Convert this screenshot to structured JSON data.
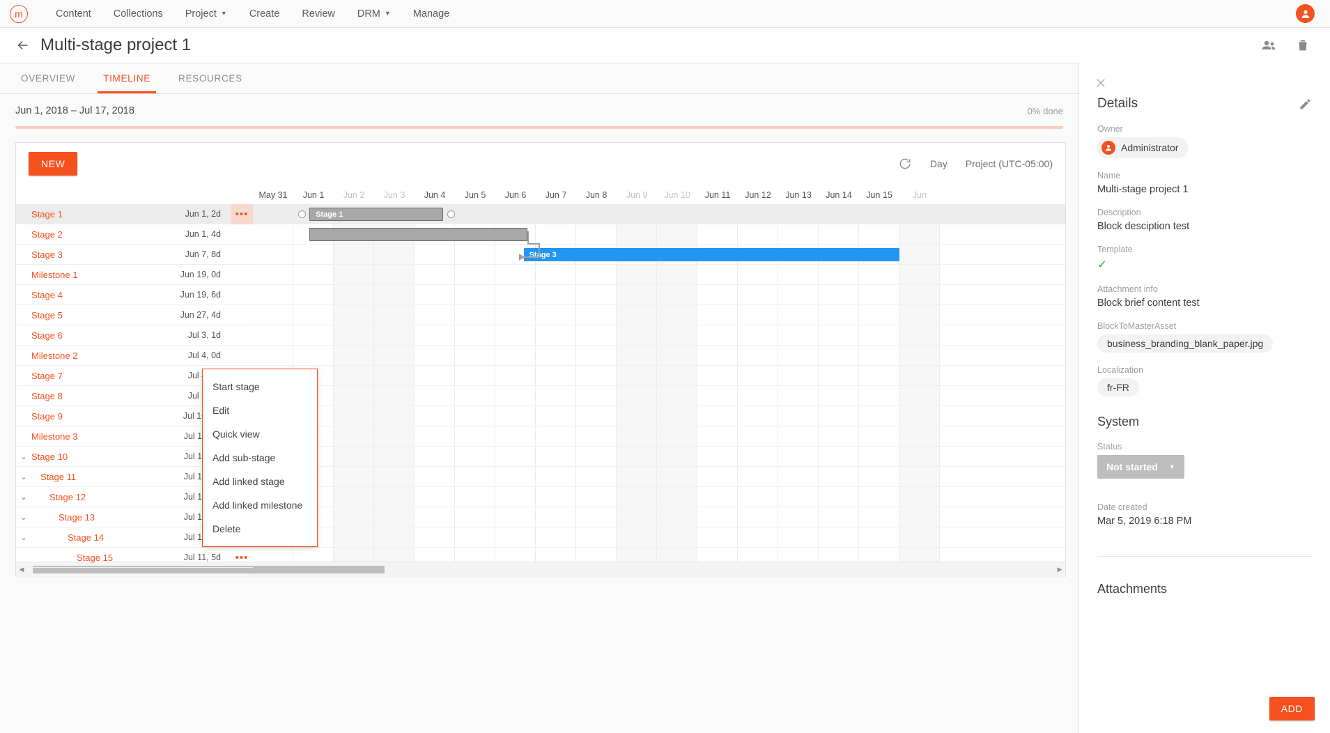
{
  "topnav": {
    "logo_letter": "m",
    "items": [
      {
        "label": "Content",
        "caret": false
      },
      {
        "label": "Collections",
        "caret": false
      },
      {
        "label": "Project",
        "caret": true
      },
      {
        "label": "Create",
        "caret": false
      },
      {
        "label": "Review",
        "caret": false
      },
      {
        "label": "DRM",
        "caret": true
      },
      {
        "label": "Manage",
        "caret": false
      }
    ]
  },
  "header": {
    "title": "Multi-stage project 1",
    "back_icon": "arrow-left-icon",
    "share_icon": "people-icon",
    "delete_icon": "trash-icon"
  },
  "tabs": [
    {
      "label": "OVERVIEW",
      "active": false
    },
    {
      "label": "TIMELINE",
      "active": true
    },
    {
      "label": "RESOURCES",
      "active": false
    }
  ],
  "summary": {
    "date_range": "Jun 1, 2018 – Jul 17, 2018",
    "done_label": "0%  done",
    "progress_percent": 0
  },
  "gantt_toolbar": {
    "new_label": "NEW",
    "refresh_icon": "refresh-icon",
    "scale_label": "Day",
    "timezone_label": "Project (UTC-05:00)"
  },
  "timeline_header": [
    {
      "label": "May 31",
      "weekend": false
    },
    {
      "label": "Jun 1",
      "weekend": false
    },
    {
      "label": "Jun 2",
      "weekend": true
    },
    {
      "label": "Jun 3",
      "weekend": true
    },
    {
      "label": "Jun 4",
      "weekend": false
    },
    {
      "label": "Jun 5",
      "weekend": false
    },
    {
      "label": "Jun 6",
      "weekend": false
    },
    {
      "label": "Jun 7",
      "weekend": false
    },
    {
      "label": "Jun 8",
      "weekend": false
    },
    {
      "label": "Jun 9",
      "weekend": true
    },
    {
      "label": "Jun 10",
      "weekend": true
    },
    {
      "label": "Jun 11",
      "weekend": false
    },
    {
      "label": "Jun 12",
      "weekend": false
    },
    {
      "label": "Jun 13",
      "weekend": false
    },
    {
      "label": "Jun 14",
      "weekend": false
    },
    {
      "label": "Jun 15",
      "weekend": false
    },
    {
      "label": "Jun",
      "weekend": true
    }
  ],
  "rows": [
    {
      "name": "Stage 1",
      "date": "Jun 1, 2d",
      "indent": 0,
      "caret": false,
      "dots": true,
      "selected": true
    },
    {
      "name": "Stage 2",
      "date": "Jun 1, 4d",
      "indent": 0,
      "caret": false,
      "dots": false,
      "selected": false
    },
    {
      "name": "Stage 3",
      "date": "Jun 7, 8d",
      "indent": 0,
      "caret": false,
      "dots": false,
      "selected": false
    },
    {
      "name": "Milestone 1",
      "date": "Jun 19, 0d",
      "indent": 0,
      "caret": false,
      "dots": false,
      "selected": false
    },
    {
      "name": "Stage 4",
      "date": "Jun 19, 6d",
      "indent": 0,
      "caret": false,
      "dots": false,
      "selected": false
    },
    {
      "name": "Stage 5",
      "date": "Jun 27, 4d",
      "indent": 0,
      "caret": false,
      "dots": false,
      "selected": false
    },
    {
      "name": "Stage 6",
      "date": "Jul 3, 1d",
      "indent": 0,
      "caret": false,
      "dots": false,
      "selected": false
    },
    {
      "name": "Milestone 2",
      "date": "Jul 4, 0d",
      "indent": 0,
      "caret": false,
      "dots": false,
      "selected": false
    },
    {
      "name": "Stage 7",
      "date": "Jul 4, 3d",
      "indent": 0,
      "caret": false,
      "dots": false,
      "selected": false
    },
    {
      "name": "Stage 8",
      "date": "Jul 9, 1d",
      "indent": 0,
      "caret": false,
      "dots": true,
      "selected": false
    },
    {
      "name": "Stage 9",
      "date": "Jul 10, 1d",
      "indent": 0,
      "caret": false,
      "dots": true,
      "selected": false
    },
    {
      "name": "Milestone 3",
      "date": "Jul 11, 0d",
      "indent": 0,
      "caret": false,
      "dots": true,
      "selected": false
    },
    {
      "name": "Stage 10",
      "date": "Jul 11, 5d",
      "indent": 0,
      "caret": true,
      "dots": true,
      "selected": false
    },
    {
      "name": "Stage 11",
      "date": "Jul 11, 5d",
      "indent": 1,
      "caret": true,
      "dots": true,
      "selected": false
    },
    {
      "name": "Stage 12",
      "date": "Jul 11, 5d",
      "indent": 2,
      "caret": true,
      "dots": true,
      "selected": false
    },
    {
      "name": "Stage 13",
      "date": "Jul 11, 5d",
      "indent": 3,
      "caret": true,
      "dots": true,
      "selected": false
    },
    {
      "name": "Stage 14",
      "date": "Jul 11, 5d",
      "indent": 4,
      "caret": true,
      "dots": true,
      "selected": false
    },
    {
      "name": "Stage 15",
      "date": "Jul 11, 5d",
      "indent": 5,
      "caret": false,
      "dots": true,
      "selected": false
    }
  ],
  "bars": [
    {
      "label": "Stage 1",
      "row": 0,
      "start_col": 1.4,
      "span": 3.3,
      "color": "grey",
      "handles": true
    },
    {
      "label": "",
      "row": 1,
      "start_col": 1.4,
      "span": 5.4,
      "color": "grey",
      "handles": false
    },
    {
      "label": "Stage 3",
      "row": 2,
      "start_col": 6.7,
      "span": 9.3,
      "color": "blue",
      "handles": false
    }
  ],
  "context_menu": {
    "items": [
      {
        "label": "Start stage"
      },
      {
        "label": "Edit"
      },
      {
        "label": "Quick view"
      },
      {
        "label": "Add sub-stage"
      },
      {
        "label": "Add linked stage"
      },
      {
        "label": "Add linked milestone"
      },
      {
        "label": "Delete"
      }
    ]
  },
  "sidebar": {
    "close_icon": "close-icon",
    "title": "Details",
    "edit_icon": "pencil-icon",
    "fields": [
      {
        "label": "Owner",
        "value": "Administrator",
        "type": "avatar-chip"
      },
      {
        "label": "Name",
        "value": "Multi-stage project 1",
        "type": "text"
      },
      {
        "label": "Description",
        "value": "Block desciption test",
        "type": "text"
      },
      {
        "label": "Template",
        "value": "✓",
        "type": "check"
      },
      {
        "label": "Attachment info",
        "value": "Block brief content test",
        "type": "text"
      },
      {
        "label": "BlockToMasterAsset",
        "value": "business_branding_blank_paper.jpg",
        "type": "chip"
      },
      {
        "label": "Localization",
        "value": "fr-FR",
        "type": "chip"
      }
    ],
    "system": {
      "section_title": "System",
      "status_label": "Status",
      "status_value": "Not started",
      "date_created_label": "Date created",
      "date_created_value": "Mar 5, 2019 6:18 PM"
    },
    "attachments": {
      "section_title": "Attachments",
      "add_label": "ADD"
    }
  },
  "colors": {
    "accent": "#f4511e",
    "bar_blue": "#2196f3",
    "bar_grey": "#a8a8a8",
    "check_green": "#3fa83f",
    "status_grey": "#bdbdbd"
  }
}
